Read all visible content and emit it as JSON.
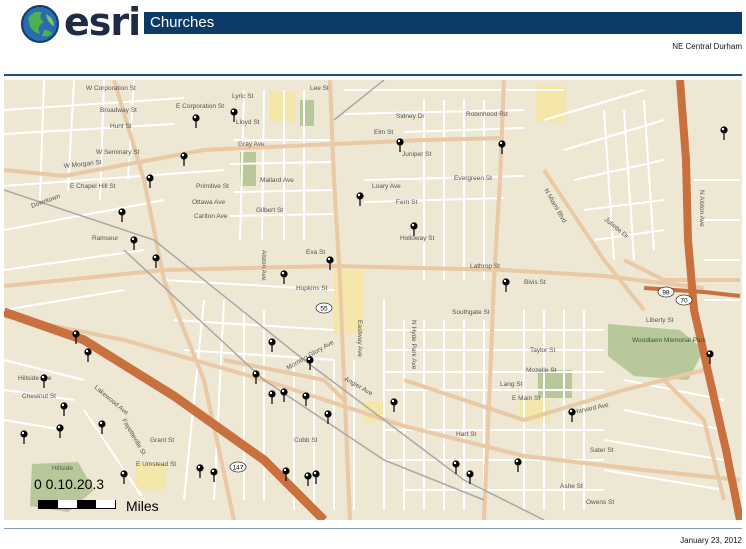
{
  "header": {
    "brand": "esri",
    "title": "Churches",
    "subtitle": "NE Central Durham"
  },
  "footer": {
    "date": "January 23, 2012"
  },
  "scale": {
    "ticks": "0 0.10.20.3",
    "units": "Miles"
  },
  "map": {
    "colors": {
      "land": "#ede7d4",
      "minor_road": "#ffffff",
      "major_road": "#e9c9a6",
      "highway": "#c9703f",
      "park": "#b9c89a",
      "building": "#f5e6a9",
      "rail": "#a8a8a8"
    },
    "labels": [
      {
        "text": "W Corporation St"
      },
      {
        "text": "E Corporation St"
      },
      {
        "text": "Lyric St"
      },
      {
        "text": "Lee St"
      },
      {
        "text": "Broadway St"
      },
      {
        "text": "Hunt St"
      },
      {
        "text": "Lloyd St"
      },
      {
        "text": "Gray Ave"
      },
      {
        "text": "W Seminary St"
      },
      {
        "text": "W Morgan St"
      },
      {
        "text": "E Chapel Hill St"
      },
      {
        "text": "Primitive St"
      },
      {
        "text": "Ottawa Ave"
      },
      {
        "text": "Carlton Ave"
      },
      {
        "text": "Mallard Ave"
      },
      {
        "text": "Gilbert St"
      },
      {
        "text": "Juniper St"
      },
      {
        "text": "Elm St"
      },
      {
        "text": "Sidney Dr"
      },
      {
        "text": "Robinhood Rd"
      },
      {
        "text": "Evergreen St"
      },
      {
        "text": "Loary Ave"
      },
      {
        "text": "Fern St"
      },
      {
        "text": "Holloway St"
      },
      {
        "text": "Eva St"
      },
      {
        "text": "Hopkins St"
      },
      {
        "text": "Lathrop St"
      },
      {
        "text": "Bivis St"
      },
      {
        "text": "Southgate St"
      },
      {
        "text": "Taylor St"
      },
      {
        "text": "Mozelle St"
      },
      {
        "text": "Lang St"
      },
      {
        "text": "E Main St"
      },
      {
        "text": "Hart St"
      },
      {
        "text": "Sater St"
      },
      {
        "text": "Ashe St"
      },
      {
        "text": "Owens St"
      },
      {
        "text": "Liberty St"
      },
      {
        "text": "Harvard Ave"
      },
      {
        "text": "E Umstead St"
      },
      {
        "text": "Hillside Ave"
      },
      {
        "text": "Chestnut St"
      },
      {
        "text": "Lakewood Ave"
      },
      {
        "text": "Angier Ave"
      },
      {
        "text": "Morning Glory Ave"
      },
      {
        "text": "Cobb St"
      },
      {
        "text": "Grant St"
      },
      {
        "text": "N Alston Ave"
      },
      {
        "text": "N Hyde Park Ave"
      },
      {
        "text": "N Miami Blvd"
      },
      {
        "text": "Fayetteville St"
      },
      {
        "text": "Woodlawn Memorial Park"
      },
      {
        "text": "Hillside"
      },
      {
        "text": "Ramseur"
      },
      {
        "text": "Downtown"
      },
      {
        "text": "Eastway Ave"
      },
      {
        "text": "Alston Ave"
      },
      {
        "text": "Juliette Dr"
      }
    ],
    "shields": [
      {
        "text": "55"
      },
      {
        "text": "98"
      },
      {
        "text": "70"
      },
      {
        "text": "147"
      }
    ],
    "church_count": 41
  }
}
